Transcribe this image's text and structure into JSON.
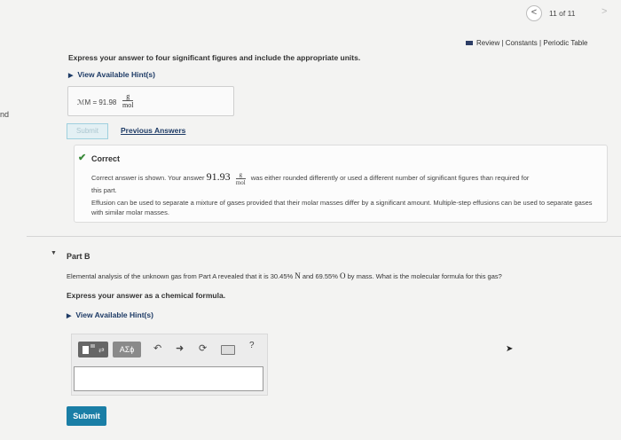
{
  "pager": {
    "prev": "<",
    "text": "11 of 11",
    "next": ">"
  },
  "top_links": {
    "review": "Review",
    "constants": "Constants",
    "periodic": "Periodic Table",
    "sep": "|"
  },
  "side_text": "nd",
  "part_a": {
    "instruction": "Express your answer to four significant figures and include the appropriate units.",
    "hint_link": "View Available Hint(s)",
    "answer_label": "ℳM =",
    "answer_value": "91.98",
    "unit_num": "g",
    "unit_den": "mol",
    "submit_label": "Submit",
    "previous_answers": "Previous Answers"
  },
  "feedback": {
    "title": "Correct",
    "line1_pre": "Correct answer is shown. Your answer",
    "line1_value": "91.93",
    "unit_num": "g",
    "unit_den": "mol",
    "line1_post": "was either rounded differently or used a different number of significant figures than required for",
    "line2": "this part.",
    "line3": "Effusion can be used to separate a mixture of gases provided that their molar masses differ by a significant amount. Multiple-step effusions can be used to separate gases with similar molar masses."
  },
  "part_b": {
    "title": "Part B",
    "question_pre": "Elemental analysis of the unknown gas from Part A revealed that it is",
    "pct_n": "30.45%",
    "elem_n": "N",
    "and": "and",
    "pct_o": "69.55%",
    "elem_o": "O",
    "question_post": "by mass. What is the molecular formula for this gas?",
    "instruction": "Express your answer as a chemical formula.",
    "hint_link": "View Available Hint(s)",
    "greek_button": "AΣϕ",
    "help_button": "?",
    "submit_label": "Submit"
  },
  "icons": {
    "undo": "undo-icon",
    "redo": "redo-icon",
    "reset": "reset-icon",
    "keyboard": "keyboard-icon",
    "help": "help-icon"
  },
  "colors": {
    "accent_blue": "#1a7ea6",
    "link_navy": "#1e3b66",
    "correct_green": "#3a8a3a"
  }
}
